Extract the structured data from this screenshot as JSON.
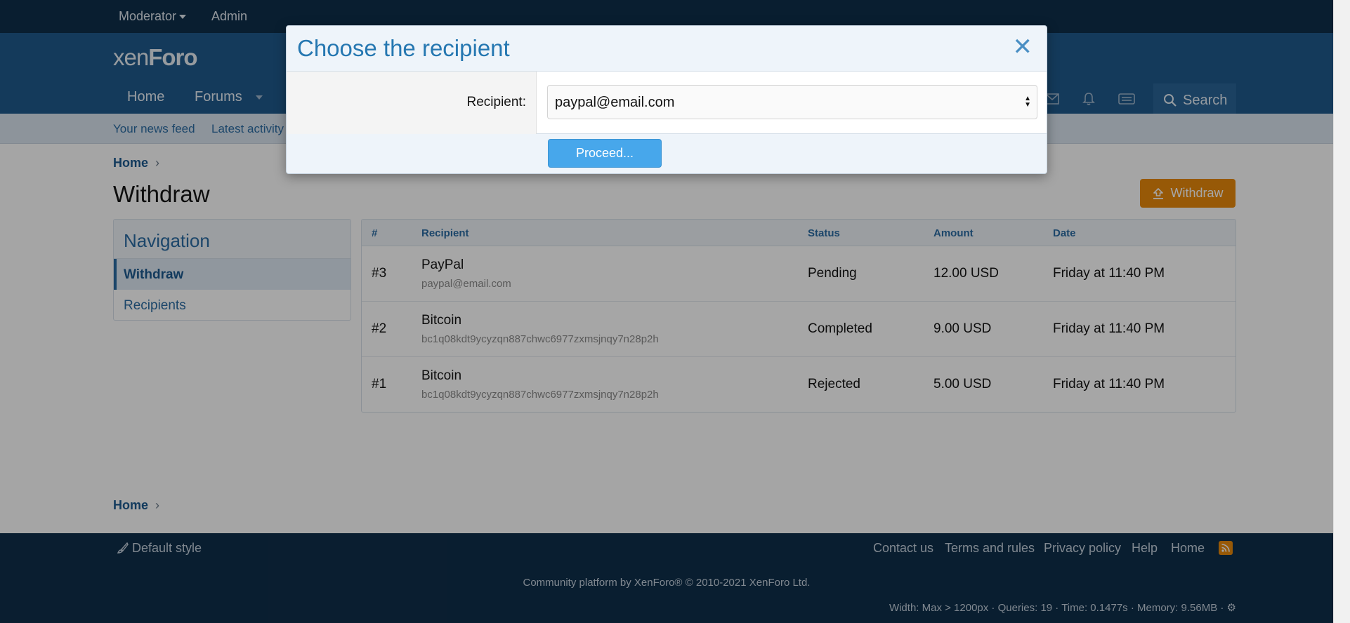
{
  "topbar": {
    "moderator": "Moderator",
    "admin": "Admin"
  },
  "header": {
    "logo_a": "xen",
    "logo_b": "Foro",
    "tabs": [
      "Home",
      "Forums"
    ],
    "search_label": "Search"
  },
  "subnav": {
    "links": [
      "Your news feed",
      "Latest activity"
    ]
  },
  "breadcrumb": {
    "top": "Home",
    "bottom": "Home"
  },
  "page": {
    "title": "Withdraw",
    "withdraw_button": "Withdraw"
  },
  "navigation": {
    "title": "Navigation",
    "items": [
      {
        "label": "Withdraw",
        "active": true
      },
      {
        "label": "Recipients",
        "active": false
      }
    ]
  },
  "table": {
    "headers": [
      "#",
      "Recipient",
      "Status",
      "Amount",
      "Date"
    ],
    "rows": [
      {
        "id": "#3",
        "name": "PayPal",
        "detail": "paypal@email.com",
        "status": "Pending",
        "amount": "12.00 USD",
        "date": "Friday at 11:40 PM"
      },
      {
        "id": "#2",
        "name": "Bitcoin",
        "detail": "bc1q08kdt9ycyzqn887chwc6977zxmsjnqy7n28p2h",
        "status": "Completed",
        "amount": "9.00 USD",
        "date": "Friday at 11:40 PM"
      },
      {
        "id": "#1",
        "name": "Bitcoin",
        "detail": "bc1q08kdt9ycyzqn887chwc6977zxmsjnqy7n28p2h",
        "status": "Rejected",
        "amount": "5.00 USD",
        "date": "Friday at 11:40 PM"
      }
    ]
  },
  "footer": {
    "style": "Default style",
    "links": [
      "Contact us",
      "Terms and rules",
      "Privacy policy",
      "Help",
      "Home"
    ],
    "copyright": "Community platform by XenForo® © 2010-2021 XenForo Ltd.",
    "debug": "Width: Max > 1200px · Queries: 19 · Time: 0.1477s · Memory: 9.56MB ·"
  },
  "modal": {
    "title": "Choose the recipient",
    "close_symbol": "✕",
    "field_label": "Recipient:",
    "selected_value": "paypal@email.com",
    "proceed_label": "Proceed..."
  },
  "colors": {
    "accent": "#2b6ca3",
    "header": "#1f5a8c",
    "topbar": "#0f2e4a",
    "withdraw": "#e8890c",
    "proceed": "#47a7eb"
  }
}
